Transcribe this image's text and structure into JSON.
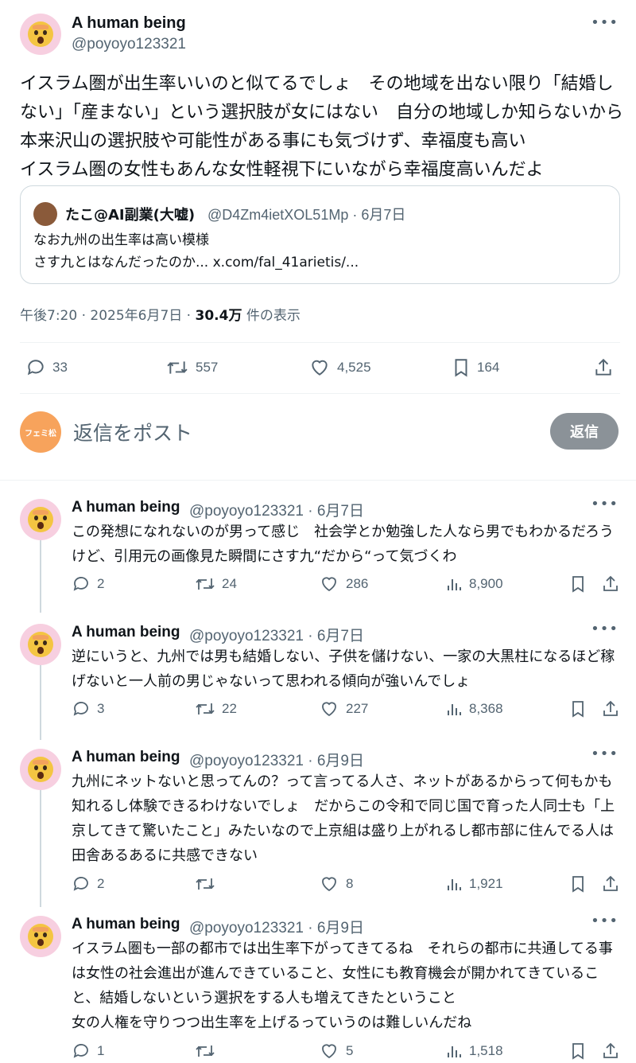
{
  "main_tweet": {
    "name": "A human being",
    "handle": "@poyoyo123321",
    "text": "イスラム圏が出生率いいのと似てるでしょ　その地域を出ない限り「結婚しない」「産まない」という選択肢が女にはない　自分の地域しか知らないから本来沢山の選択肢や可能性がある事にも気づけず、幸福度も高い\nイスラム圏の女性もあんな女性軽視下にいながら幸福度高いんだよ",
    "quote": {
      "name": "たこ@AI副業(大嘘)",
      "handle_date": "@D4Zm4ietXOL51Mp · 6月7日",
      "text": "なお九州の出生率は高い模様\nさす九とはなんだったのか... x.com/fal_41arietis/..."
    },
    "meta_time": "午後7:20 · 2025年6月7日 · ",
    "meta_views": "30.4万",
    "meta_views_label": " 件の表示",
    "stats": {
      "replies": "33",
      "retweets": "557",
      "likes": "4,525",
      "bookmarks": "164"
    }
  },
  "reply_box": {
    "avatar_text": "フェミ松",
    "placeholder": "返信をポスト",
    "button": "返信"
  },
  "replies": [
    {
      "name": "A human being",
      "handle_date": "@poyoyo123321 · 6月7日",
      "text": "この発想になれないのが男って感じ　社会学とか勉強した人なら男でもわかるだろうけど、引用元の画像見た瞬間にさす九“だから“って気づくわ",
      "replies": "2",
      "retweets": "24",
      "likes": "286",
      "views": "8,900"
    },
    {
      "name": "A human being",
      "handle_date": "@poyoyo123321 · 6月7日",
      "text": "逆にいうと、九州では男も結婚しない、子供を儲けない、一家の大黒柱になるほど稼げないと一人前の男じゃないって思われる傾向が強いんでしょ",
      "replies": "3",
      "retweets": "22",
      "likes": "227",
      "views": "8,368"
    },
    {
      "name": "A human being",
      "handle_date": "@poyoyo123321 · 6月9日",
      "text": "九州にネットないと思ってんの？って言ってる人さ、ネットがあるからって何もかも知れるし体験できるわけないでしょ　だからこの令和で同じ国で育った人同士も「上京してきて驚いたこと」みたいなので上京組は盛り上がれるし都市部に住んでる人は田舎あるあるに共感できない",
      "replies": "2",
      "retweets": "",
      "likes": "8",
      "views": "1,921"
    },
    {
      "name": "A human being",
      "handle_date": "@poyoyo123321 · 6月9日",
      "text": "イスラム圏も一部の都市では出生率下がってきてるね　それらの都市に共通してる事は女性の社会進出が進んできていること、女性にも教育機会が開かれてきていること、結婚しないという選択をする人も増えてきたということ\n女の人権を守りつつ出生率を上げるっていうのは難しいんだね",
      "replies": "1",
      "retweets": "",
      "likes": "5",
      "views": "1,518"
    }
  ]
}
